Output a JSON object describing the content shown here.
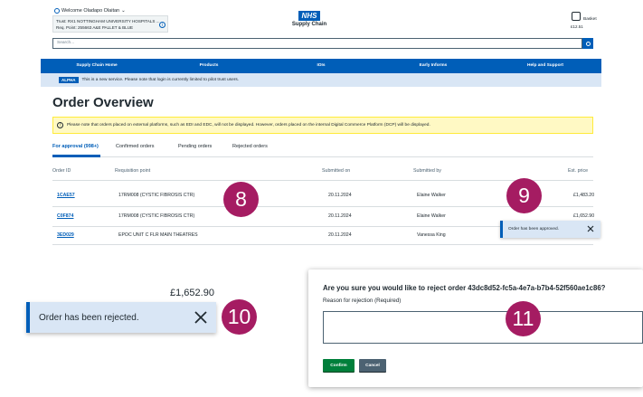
{
  "header": {
    "welcome": "Welcome Oladapo Olaitan",
    "trust_line": "Trust: RX1 NOTTINGHAM UNIVERSITY HOSPITALS ...",
    "req_point_line": "Req. Point: 255663 A&E PALLET & BLUE",
    "logo_text": "NHS",
    "logo_subtitle": "Supply Chain",
    "basket_label": "Basket",
    "basket_total": "£12.51",
    "search_placeholder": "Search..."
  },
  "nav": {
    "items": [
      "Supply Chain Home",
      "Products",
      "IOIs",
      "Early Informs",
      "Help and Support"
    ]
  },
  "alpha": {
    "tag": "ALPHA",
    "message": "This is a new service. Please note that login is currently limited to pilot trust users."
  },
  "page": {
    "title": "Order Overview",
    "warning": "Please note that orders placed on external platforms, such as EDI and EDC, will not be displayed. However, orders placed on the internal Digital Commerce Platform (DCP) will be displayed."
  },
  "tabs": [
    "For approval (998+)",
    "Confirmed orders",
    "Pending orders",
    "Rejected orders"
  ],
  "table": {
    "headers": [
      "Order ID",
      "Requisition point",
      "Submitted on",
      "Submitted by",
      "Est. price"
    ],
    "rows": [
      {
        "id": "1CAE57",
        "req": "17RM008 (CYSTIC FIBROSIS CTR)",
        "date": "20.11.2024",
        "by": "Elaine Walker",
        "price": "£1,483.20"
      },
      {
        "id": "C0F874",
        "req": "17RM008 (CYSTIC FIBROSIS CTR)",
        "date": "20.11.2024",
        "by": "Elaine Walker",
        "price": "£1,652.90"
      },
      {
        "id": "3ED029",
        "req": "EPOC UNIT C FLR MAIN THEATRES",
        "date": "20.11.2024",
        "by": "Vanessa King",
        "price": ""
      }
    ]
  },
  "toast_approved": "Order has been approved.",
  "rejected_zoom": {
    "price": "£1,652.90",
    "toast": "Order has been rejected."
  },
  "dialog": {
    "title": "Are you sure you would like to reject order 43dc8d52-fc5a-4e7a-b7b4-52f560ae1c86?",
    "label": "Reason for rejection (Required)",
    "confirm": "Confirm",
    "cancel": "Cancel"
  },
  "badges": [
    "8",
    "9",
    "10",
    "11"
  ],
  "colors": {
    "nhs_blue": "#005eb8",
    "badge_magenta": "#a51c62",
    "confirm_green": "#007f3b",
    "cancel_grey": "#4c6272",
    "toast_bg": "#d9e6f5",
    "warning_bg": "#fff9c4"
  }
}
